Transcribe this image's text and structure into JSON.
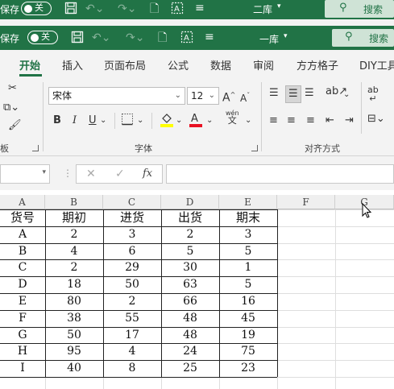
{
  "titlebar_back": {
    "autosave_label": "保存",
    "toggle_text": "关",
    "doc_name": "二库",
    "search_label": "搜索"
  },
  "titlebar": {
    "autosave_label": "保存",
    "toggle_text": "关",
    "doc_name": "一库",
    "search_label": "搜索"
  },
  "tabs": [
    "开始",
    "插入",
    "页面布局",
    "公式",
    "数据",
    "审阅",
    "方方格子",
    "DIY工具"
  ],
  "ribbon": {
    "font_name": "宋体",
    "font_size": "12",
    "bold": "B",
    "italic": "I",
    "underline": "U",
    "group_clipboard": "板",
    "group_font": "字体",
    "group_alignment": "对齐方式",
    "phonetic_label": "wén",
    "phonetic_char": "文",
    "wrap_label": "ab",
    "font_color_hex": "#e81123",
    "highlight_color_hex": "#ffff00"
  },
  "formula_bar": {
    "cancel_symbol": "✕",
    "enter_symbol": "✓",
    "fx_label": "fx",
    "value": ""
  },
  "columns": [
    "A",
    "B",
    "C",
    "D",
    "E",
    "F",
    "G"
  ],
  "table": {
    "headers": [
      "货号",
      "期初",
      "进货",
      "出货",
      "期末"
    ],
    "rows": [
      [
        "A",
        "2",
        "3",
        "2",
        "3"
      ],
      [
        "B",
        "4",
        "6",
        "5",
        "5"
      ],
      [
        "C",
        "2",
        "29",
        "30",
        "1"
      ],
      [
        "D",
        "18",
        "50",
        "63",
        "5"
      ],
      [
        "E",
        "80",
        "2",
        "66",
        "16"
      ],
      [
        "F",
        "38",
        "55",
        "48",
        "45"
      ],
      [
        "G",
        "50",
        "17",
        "48",
        "19"
      ],
      [
        "H",
        "95",
        "4",
        "24",
        "75"
      ],
      [
        "I",
        "40",
        "8",
        "25",
        "23"
      ]
    ]
  },
  "colors": {
    "brand_green": "#217346",
    "search_bg": "#cfe3d6"
  }
}
